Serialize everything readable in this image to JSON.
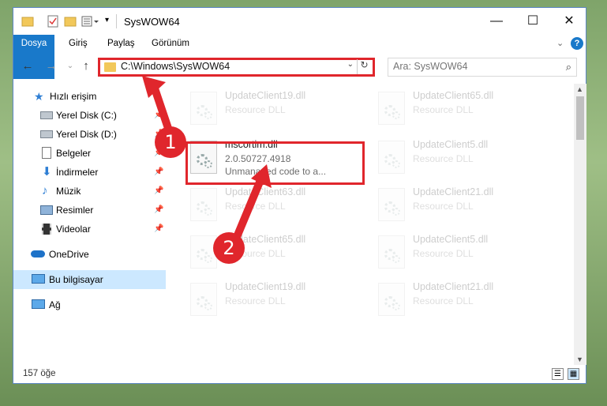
{
  "window": {
    "title": "SysWOW64",
    "controls": {
      "minimize": "—",
      "maximize": "☐",
      "close": "✕"
    }
  },
  "ribbon": {
    "tabs": [
      {
        "label": "Dosya"
      },
      {
        "label": "Giriş"
      },
      {
        "label": "Paylaş"
      },
      {
        "label": "Görünüm"
      }
    ]
  },
  "address": {
    "path": "C:\\Windows\\SysWOW64"
  },
  "search": {
    "placeholder": "Ara: SysWOW64"
  },
  "sidebar": {
    "items": [
      {
        "label": "Hızlı erişim",
        "icon": "star-icon"
      },
      {
        "label": "Yerel Disk (C:)",
        "icon": "drive-icon"
      },
      {
        "label": "Yerel Disk (D:)",
        "icon": "drive-icon"
      },
      {
        "label": "Belgeler",
        "icon": "documents-icon"
      },
      {
        "label": "İndirmeler",
        "icon": "download-icon"
      },
      {
        "label": "Müzik",
        "icon": "music-icon"
      },
      {
        "label": "Resimler",
        "icon": "pictures-icon"
      },
      {
        "label": "Videolar",
        "icon": "videos-icon"
      },
      {
        "label": "OneDrive",
        "icon": "cloud-icon"
      },
      {
        "label": "Bu bilgisayar",
        "icon": "computer-icon"
      },
      {
        "label": "Ağ",
        "icon": "network-icon"
      }
    ]
  },
  "files": [
    {
      "name": "UpdateClient19.dll",
      "type": "Resource DLL"
    },
    {
      "name": "UpdateClient65.dll",
      "type": "Resource DLL"
    },
    {
      "name": "mscortim.dll",
      "version": "2.0.50727.4918",
      "description": "Unmanaged code to a..."
    },
    {
      "name": "UpdateClient5.dll",
      "type": "Resource DLL"
    },
    {
      "name": "UpdateClient63.dll",
      "type": "Resource DLL"
    },
    {
      "name": "UpdateClient21.dll",
      "type": "Resource DLL"
    },
    {
      "name": "UpdateClient65.dll",
      "type": "Resource DLL"
    },
    {
      "name": "UpdateClient5.dll",
      "type": "Resource DLL"
    },
    {
      "name": "UpdateClient19.dll",
      "type": "Resource DLL"
    },
    {
      "name": "UpdateClient21.dll",
      "type": "Resource DLL"
    }
  ],
  "status": {
    "count": "157 öğe"
  },
  "annotations": {
    "step1": "1",
    "step2": "2",
    "color": "#e0262c"
  }
}
